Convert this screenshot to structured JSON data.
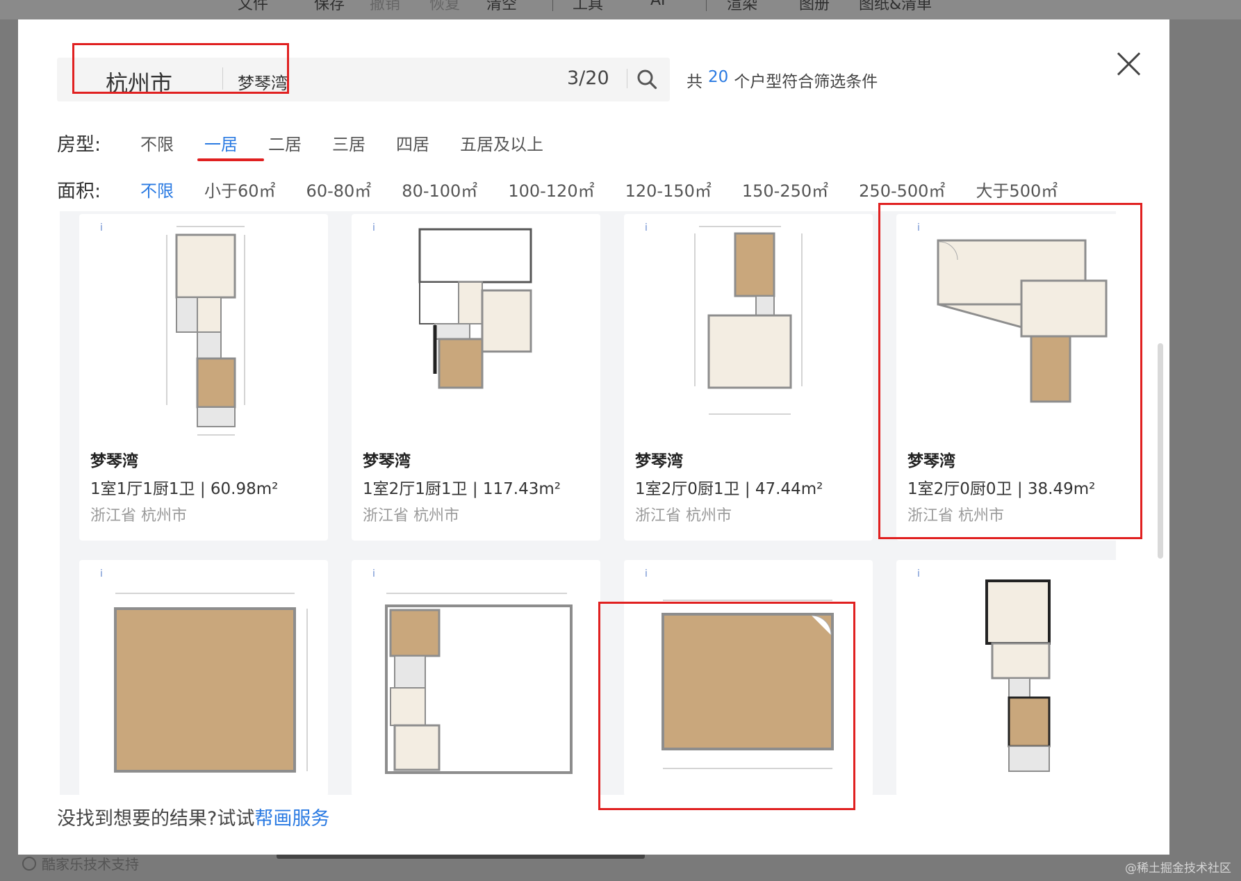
{
  "background": {
    "menu": [
      "文件",
      "保存",
      "撤销",
      "恢复",
      "清空",
      "工具",
      "AI",
      "渲染",
      "图册",
      "图纸&清单"
    ],
    "support_text": "酷家乐技术支持",
    "watermark": "@稀土掘金技术社区"
  },
  "search": {
    "city": "杭州市",
    "community": "梦琴湾",
    "counter": "3/20"
  },
  "result_summary": {
    "prefix": "共",
    "count": "20",
    "suffix": "个户型符合筛选条件"
  },
  "filters": {
    "room_type": {
      "label": "房型:",
      "options": [
        "不限",
        "一居",
        "二居",
        "三居",
        "四居",
        "五居及以上"
      ],
      "selected": "一居"
    },
    "area": {
      "label": "面积:",
      "options": [
        "不限",
        "小于60㎡",
        "60-80㎡",
        "80-100㎡",
        "100-120㎡",
        "120-150㎡",
        "150-250㎡",
        "250-500㎡",
        "大于500㎡"
      ],
      "selected": "不限"
    }
  },
  "cards": [
    {
      "title": "梦琴湾",
      "spec": "1室1厅1厨1卫 | 60.98m²",
      "location": "浙江省 杭州市"
    },
    {
      "title": "梦琴湾",
      "spec": "1室2厅1厨1卫 | 117.43m²",
      "location": "浙江省 杭州市"
    },
    {
      "title": "梦琴湾",
      "spec": "1室2厅0厨1卫 | 47.44m²",
      "location": "浙江省 杭州市"
    },
    {
      "title": "梦琴湾",
      "spec": "1室2厅0厨0卫 | 38.49m²",
      "location": "浙江省 杭州市"
    },
    {
      "title": "",
      "spec": "",
      "location": ""
    },
    {
      "title": "",
      "spec": "",
      "location": ""
    },
    {
      "title": "",
      "spec": "",
      "location": ""
    },
    {
      "title": "",
      "spec": "",
      "location": ""
    }
  ],
  "footer": {
    "text": "没找到想要的结果?试试",
    "link": "帮画服务"
  },
  "colors": {
    "accent": "#2a7ae2",
    "annotation_red": "#e02020",
    "wood_floor": "#c9a77c",
    "tile_floor": "#f3ede2",
    "wall": "#8d8d8d"
  }
}
